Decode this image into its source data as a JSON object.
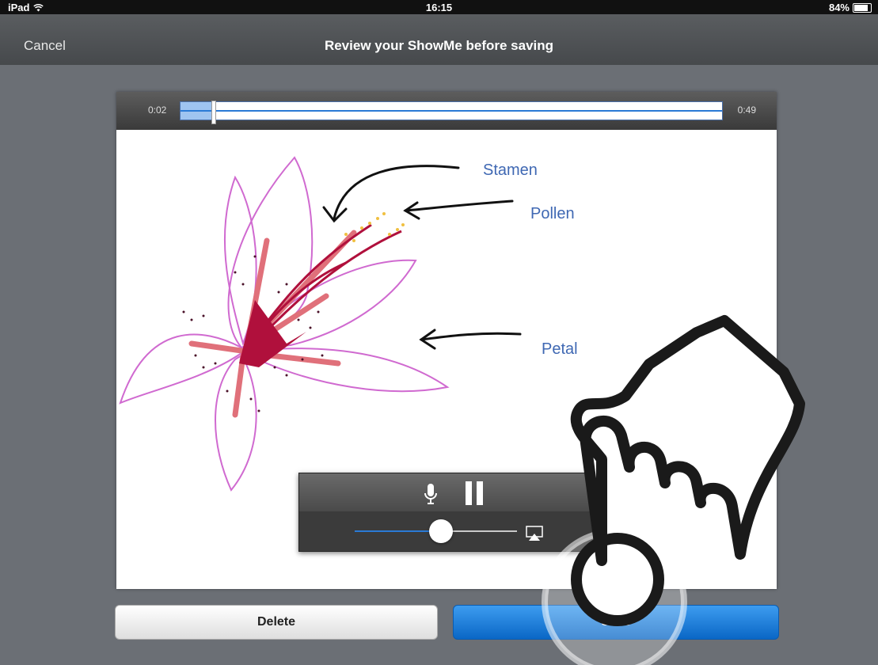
{
  "status_bar": {
    "device": "iPad",
    "time": "16:15",
    "battery": "84%",
    "battery_level": 0.84
  },
  "nav": {
    "cancel_label": "Cancel",
    "title": "Review your ShowMe before saving"
  },
  "scrubber": {
    "current_time": "0:02",
    "total_time": "0:49",
    "progress": 0.06
  },
  "drawing": {
    "labels": {
      "stamen": "Stamen",
      "pollen": "Pollen",
      "petal": "Petal"
    }
  },
  "audio": {
    "volume": 0.53
  },
  "actions": {
    "delete_label": "Delete",
    "save_label": "Save"
  },
  "colors": {
    "accent": "#2a7ad6",
    "label": "#3f68b3",
    "petal": "#d06ad0",
    "stamen": "#b0103c"
  },
  "icons": [
    "wifi-icon",
    "battery-icon",
    "microphone-icon",
    "pause-icon",
    "airplay-icon",
    "hand-pointer-icon"
  ]
}
